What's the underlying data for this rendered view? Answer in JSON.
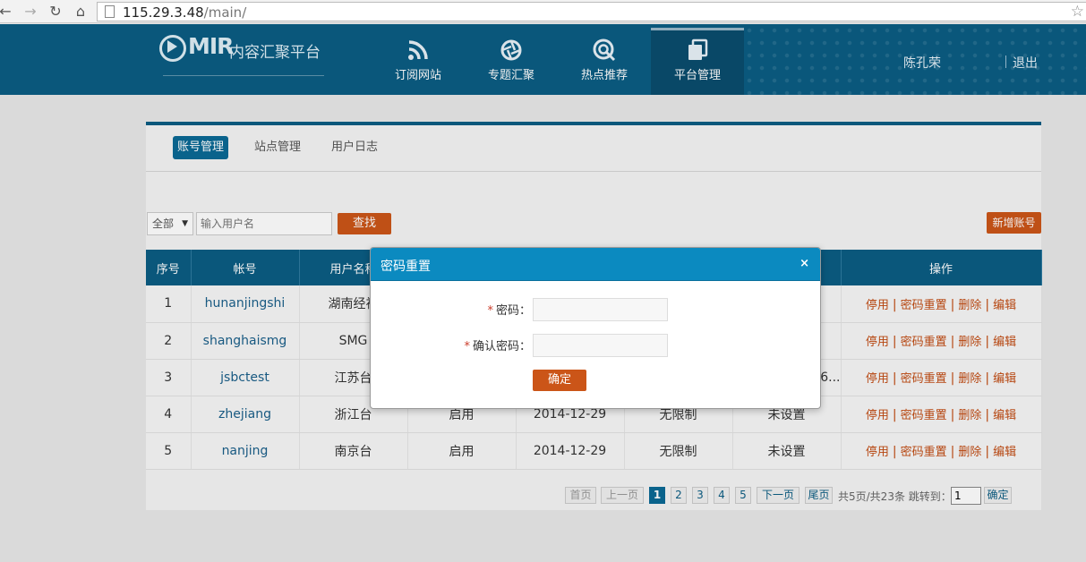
{
  "browser": {
    "url_host": "115.29.3.48",
    "url_path": "/main/"
  },
  "header": {
    "logo_brand": "MIR",
    "logo_sub": "内容汇聚平台",
    "nav": [
      {
        "label": "订阅网站",
        "icon": "rss-icon"
      },
      {
        "label": "专题汇聚",
        "icon": "aperture-icon"
      },
      {
        "label": "热点推荐",
        "icon": "target-icon"
      },
      {
        "label": "平台管理",
        "icon": "stack-icon",
        "active": true
      }
    ],
    "username": "陈孔荣",
    "logout": "退出"
  },
  "subtabs": [
    {
      "label": "账号管理",
      "active": true
    },
    {
      "label": "站点管理"
    },
    {
      "label": "用户日志"
    }
  ],
  "filter": {
    "select_value": "全部",
    "search_placeholder": "输入用户名",
    "search_button": "查找",
    "add_button": "新增账号"
  },
  "table": {
    "headers": [
      "序号",
      "帐号",
      "用户名称",
      "",
      "",
      "",
      "",
      "操作"
    ],
    "rows": [
      {
        "index": "1",
        "account": "hunanjingshi",
        "name": "湖南经视",
        "status": "",
        "date": "",
        "limit": "",
        "extra": ""
      },
      {
        "index": "2",
        "account": "shanghaismg",
        "name": "SMG",
        "status": "",
        "date": "",
        "limit": "",
        "extra": ""
      },
      {
        "index": "3",
        "account": "jsbctest",
        "name": "江苏台",
        "status": "",
        "date": "",
        "limit": "",
        "extra": "6..."
      },
      {
        "index": "4",
        "account": "zhejiang",
        "name": "浙江台",
        "status": "启用",
        "date": "2014-12-29",
        "limit": "无限制",
        "extra": "未设置"
      },
      {
        "index": "5",
        "account": "nanjing",
        "name": "南京台",
        "status": "启用",
        "date": "2014-12-29",
        "limit": "无限制",
        "extra": "未设置"
      }
    ],
    "ops": [
      "停用",
      "密码重置",
      "删除",
      "编辑"
    ]
  },
  "pager": {
    "first": "首页",
    "prev": "上一页",
    "pages": [
      "1",
      "2",
      "3",
      "4",
      "5"
    ],
    "current": "1",
    "next": "下一页",
    "last": "尾页",
    "summary": "共5页/共23条",
    "jump_label": "跳转到：",
    "jump_value": "1",
    "jump_button": "确定"
  },
  "modal": {
    "title": "密码重置",
    "close": "×",
    "password_label": "密码：",
    "confirm_label": "确认密码：",
    "required_mark": "*",
    "submit": "确定"
  },
  "colors": {
    "header_blue": "#0b5d83",
    "accent_orange": "#cb5518",
    "modal_header": "#0b8ac0"
  }
}
